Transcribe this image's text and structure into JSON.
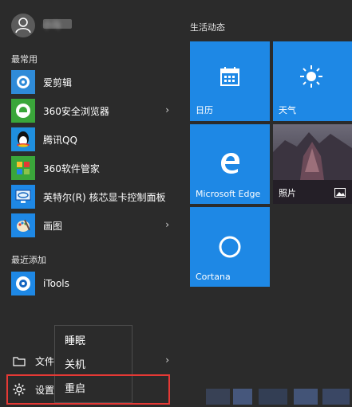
{
  "user": {
    "name": "小马"
  },
  "most_used_label": "最常用",
  "recently_added_label": "最近添加",
  "apps": [
    {
      "label": "爱剪辑",
      "icon": "aijianji-icon",
      "has_arrow": false
    },
    {
      "label": "360安全浏览器",
      "icon": "360-browser-icon",
      "has_arrow": true
    },
    {
      "label": "腾讯QQ",
      "icon": "qq-icon",
      "has_arrow": false
    },
    {
      "label": "360软件管家",
      "icon": "360-software-icon",
      "has_arrow": false
    },
    {
      "label": "英特尔(R) 核芯显卡控制面板",
      "icon": "intel-graphics-icon",
      "has_arrow": false
    },
    {
      "label": "画图",
      "icon": "paint-icon",
      "has_arrow": true
    }
  ],
  "recent_apps": [
    {
      "label": "iTools",
      "icon": "itools-icon"
    }
  ],
  "tiles_group_title": "生活动态",
  "tiles": {
    "calendar": {
      "label": "日历",
      "icon": "calendar-icon"
    },
    "weather": {
      "label": "天气",
      "icon": "sun-icon"
    },
    "edge": {
      "label": "Microsoft Edge",
      "icon": "edge-icon"
    },
    "photos": {
      "label": "照片",
      "icon": "photo-icon"
    },
    "cortana": {
      "label": "Cortana",
      "icon": "cortana-icon"
    }
  },
  "bottom": {
    "file_explorer": "文件资",
    "settings": "设置"
  },
  "power_menu": [
    "睡眠",
    "关机",
    "重启"
  ],
  "colors": {
    "tile_blue": "#1e88e5",
    "highlight": "#e53935",
    "bg": "#2b2b2b"
  }
}
